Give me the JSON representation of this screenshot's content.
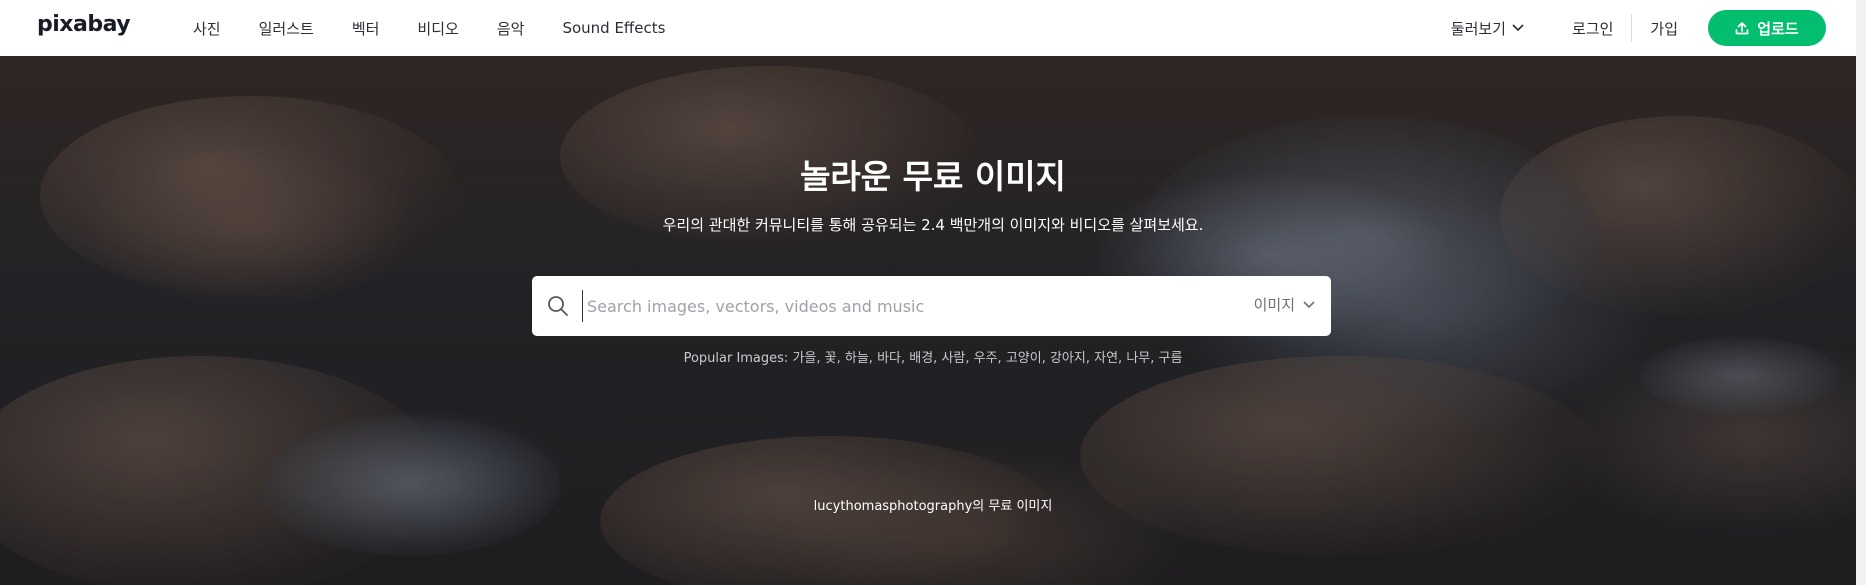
{
  "header": {
    "logo": "pixabay",
    "nav": [
      "사진",
      "일러스트",
      "벡터",
      "비디오",
      "음악",
      "Sound Effects"
    ],
    "explore_label": "둘러보기",
    "login_label": "로그인",
    "signup_label": "가입",
    "upload_label": "업로드"
  },
  "hero": {
    "title": "놀라운 무료 이미지",
    "subtitle": "우리의 관대한 커뮤니티를 통해 공유되는 2.4 백만개의 이미지와 비디오를 살펴보세요.",
    "search": {
      "placeholder": "Search images, vectors, videos and music",
      "value": "",
      "type_label": "이미지"
    },
    "popular_label": "Popular Images:",
    "popular_tags": [
      "가을",
      "꽃",
      "하늘",
      "바다",
      "배경",
      "사람",
      "우주",
      "고양이",
      "강아지",
      "자연",
      "나무",
      "구름"
    ],
    "credit": "lucythomasphotography의 무료 이미지"
  },
  "colors": {
    "accent": "#02be6e",
    "header_bg": "#ffffff",
    "text": "#2c2e36"
  },
  "icons": {
    "search": "search-icon",
    "chevron": "chevron-down-icon",
    "upload": "upload-icon"
  }
}
